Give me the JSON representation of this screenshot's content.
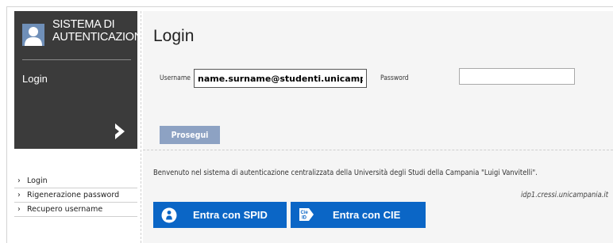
{
  "brand": {
    "line1": "SISTEMA DI",
    "line2": "AUTENTICAZIONE",
    "section": "Login"
  },
  "nav": {
    "items": [
      {
        "label": "Login"
      },
      {
        "label": "Rigenerazione password"
      },
      {
        "label": "Recupero username"
      }
    ]
  },
  "login": {
    "title": "Login",
    "username_label": "Username",
    "username_value": "name.surname@studenti.unicampania.it",
    "password_label": "Password",
    "password_value": "",
    "submit_label": "Prosegui"
  },
  "info": {
    "welcome": "Benvenuto nel sistema di autenticazione centralizzata della Università degli Studi della Campania \"Luigi Vanvitelli\".",
    "host": "idp1.cressi.unicampania.it"
  },
  "sso": {
    "spid_label": "Entra con SPID",
    "cie_label": "Entra con CIE",
    "cie_icon_text": "Cie ID"
  },
  "colors": {
    "sidebar_bg": "#3b3b3b",
    "button_blue": "#0b66c6",
    "prosegui_bg": "#8da2c3",
    "panel_bg": "#f5f5f5"
  }
}
